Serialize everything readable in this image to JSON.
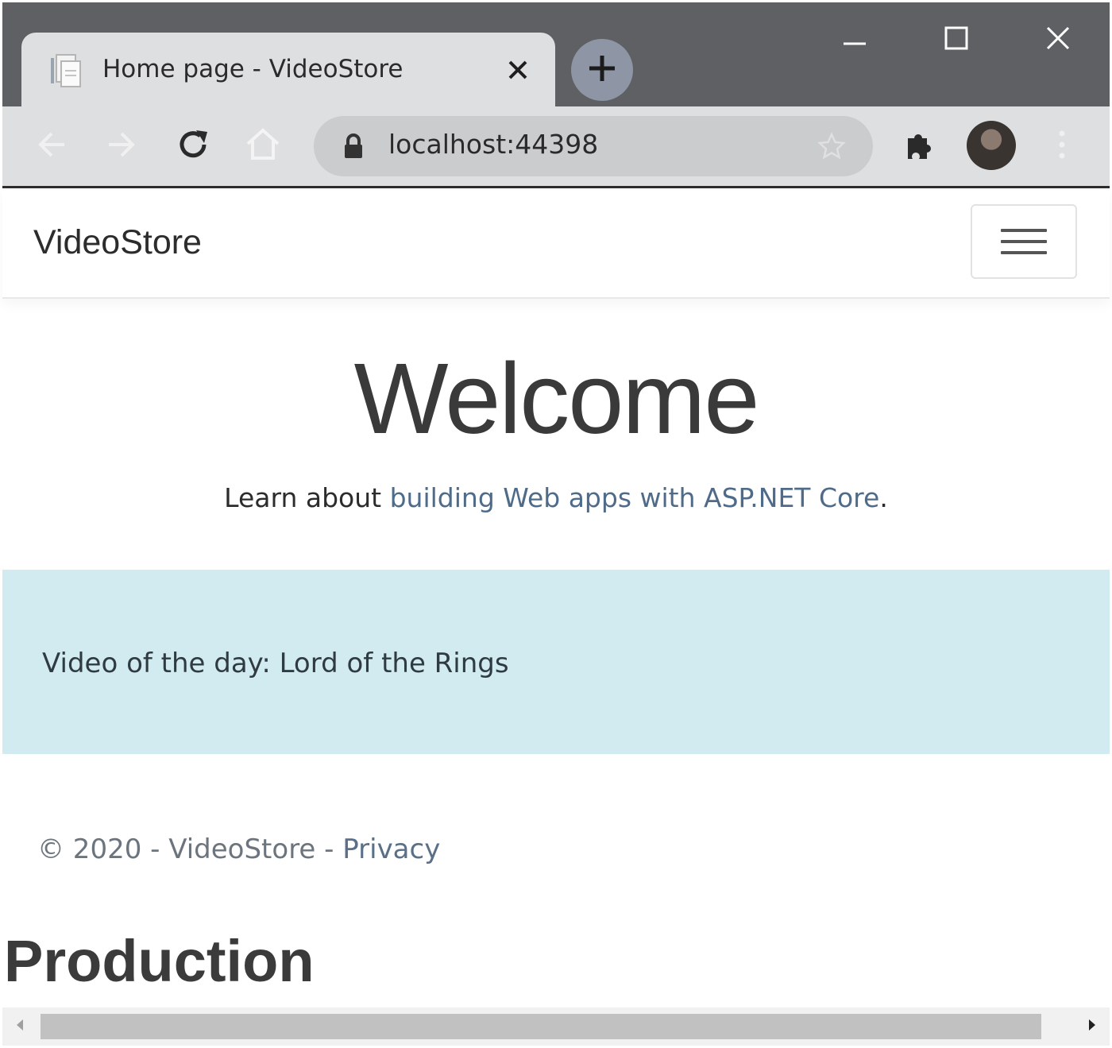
{
  "browser": {
    "tab": {
      "title": "Home page - VideoStore",
      "favicon": "document-icon"
    },
    "new_tab_icon": "plus-icon",
    "window_controls": [
      "minimize-icon",
      "maximize-icon",
      "close-icon"
    ],
    "address": {
      "url": "localhost:44398",
      "secure_icon": "lock-icon",
      "bookmark_icon": "star-icon"
    },
    "toolbar_icons": [
      "back-arrow-icon",
      "forward-arrow-icon",
      "reload-icon",
      "home-icon",
      "puzzle-icon",
      "more-vert-icon"
    ]
  },
  "page": {
    "navbar": {
      "brand": "VideoStore",
      "toggler_icon": "hamburger-icon"
    },
    "hero": {
      "heading": "Welcome",
      "lead_prefix": "Learn about ",
      "lead_link": "building Web apps with ASP.NET Core",
      "lead_suffix": "."
    },
    "video_of_the_day": {
      "text": "Video of the day: Lord of the Rings"
    },
    "footer": {
      "copyright": "© 2020 - VideoStore - ",
      "privacy_link": "Privacy"
    },
    "environment": "Production"
  },
  "colors": {
    "titlebar": "#5f6064",
    "toolbar": "#dedfe1",
    "alert_bg": "#d1ebf0",
    "link": "#4f6b8a"
  }
}
